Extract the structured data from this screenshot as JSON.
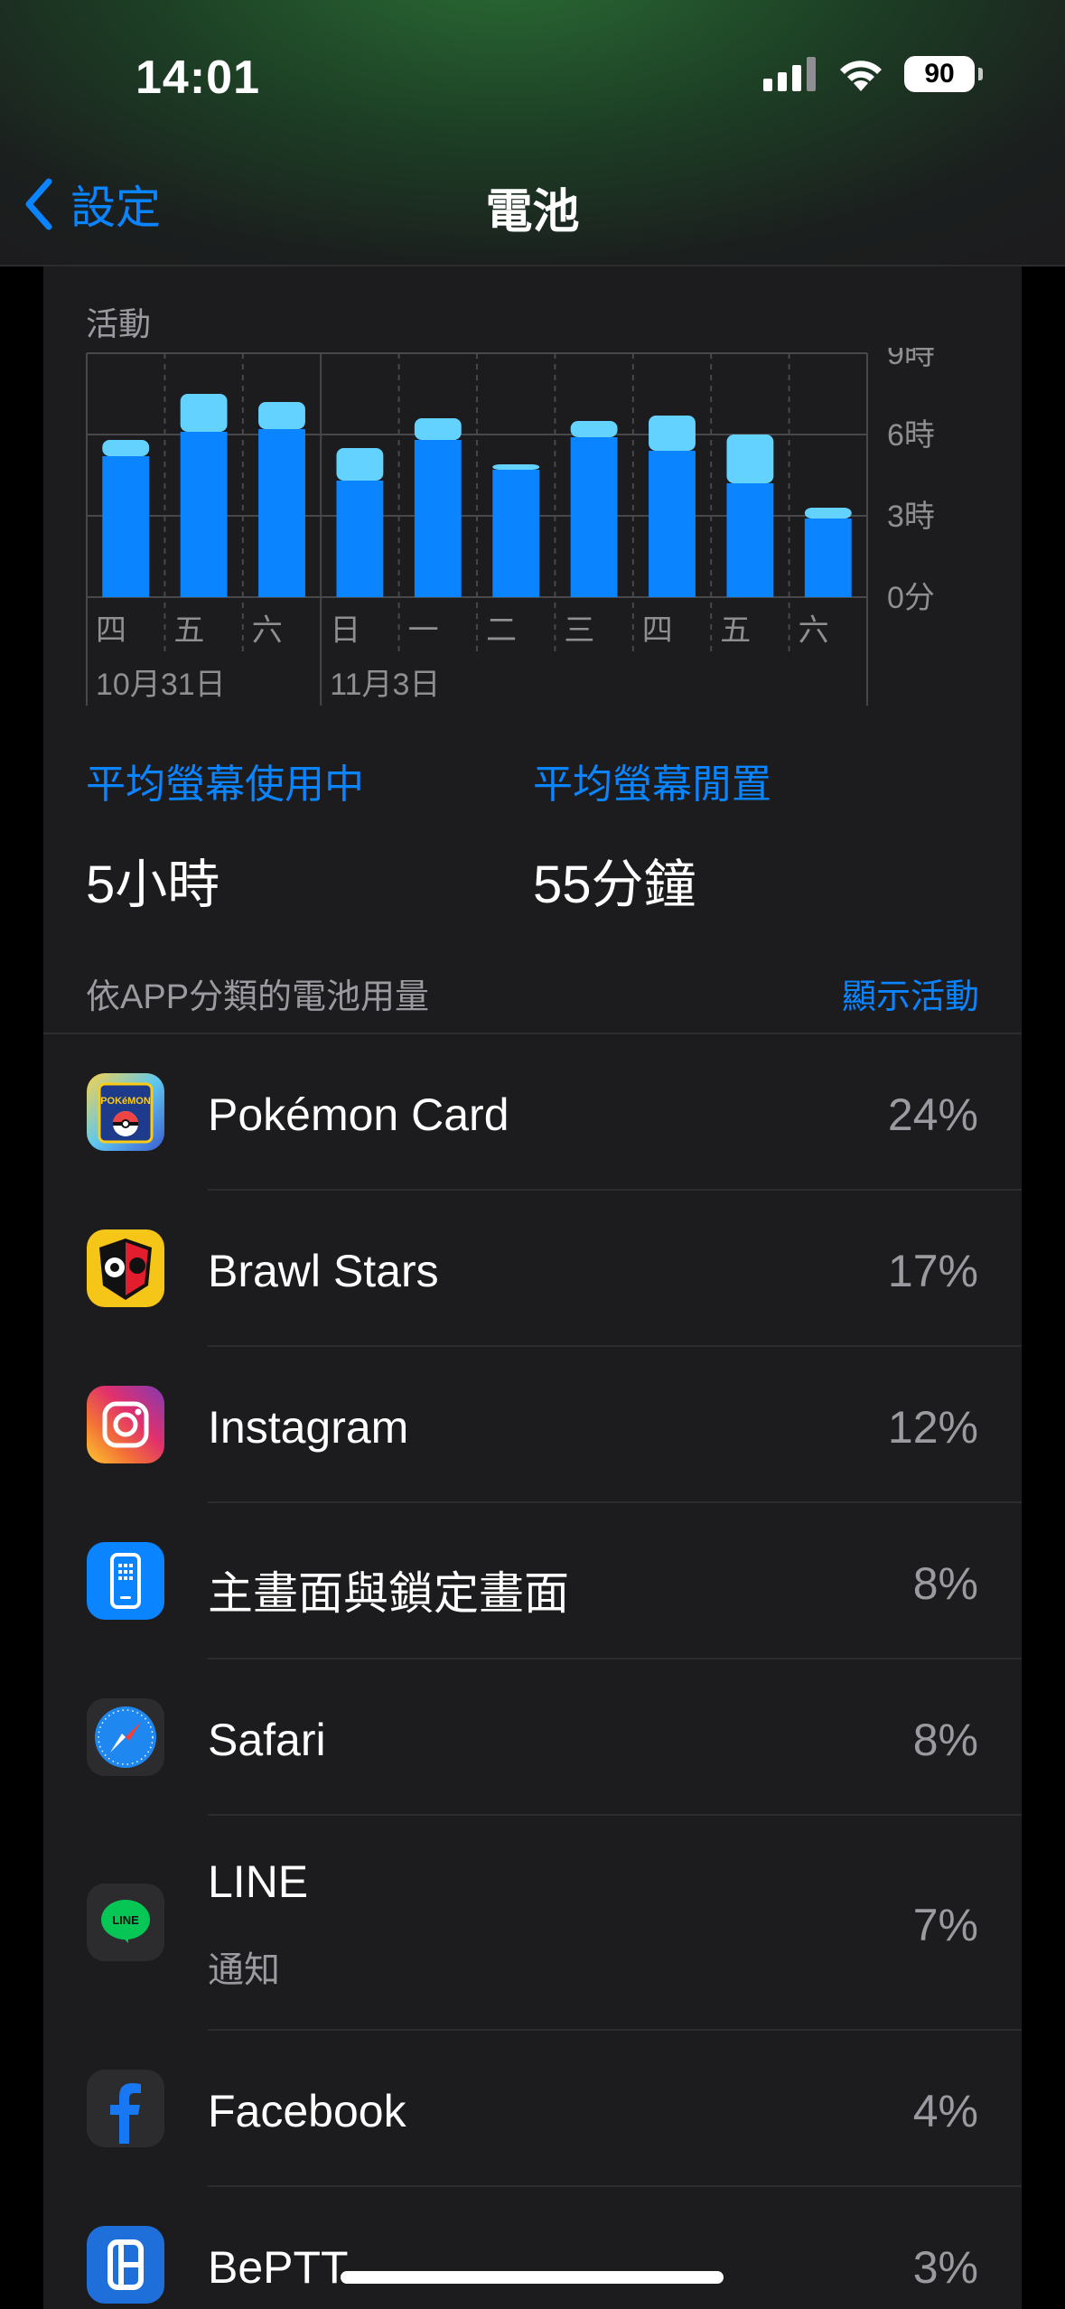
{
  "status": {
    "time": "14:01",
    "battery": "90"
  },
  "nav": {
    "back_label": "設定",
    "title": "電池"
  },
  "activity": {
    "label": "活動"
  },
  "chart_data": {
    "type": "bar",
    "title": "",
    "categories": [
      "四",
      "五",
      "六",
      "日",
      "一",
      "二",
      "三",
      "四",
      "五",
      "六"
    ],
    "date_labels": [
      {
        "index": 0,
        "text": "10月31日"
      },
      {
        "index": 3,
        "text": "11月3日"
      }
    ],
    "series": [
      {
        "name": "",
        "values": [
          5.2,
          6.1,
          6.2,
          4.3,
          5.8,
          4.7,
          5.9,
          5.4,
          4.2,
          2.9
        ],
        "color": "#0a84ff"
      },
      {
        "name": "",
        "values": [
          0.6,
          1.4,
          1.0,
          1.2,
          0.8,
          0.2,
          0.6,
          1.3,
          1.8,
          0.4
        ],
        "color": "#64d2ff"
      }
    ],
    "stacked": true,
    "y_ticks": [
      "0分",
      "3時",
      "6時",
      "9時"
    ],
    "ylim": [
      0,
      9
    ],
    "grid": true
  },
  "averages": {
    "screen_on_label": "平均螢幕使用中",
    "screen_on_value": "5小時",
    "screen_off_label": "平均螢幕閒置",
    "screen_off_value": "55分鐘"
  },
  "usage": {
    "header_label": "依APP分類的電池用量",
    "show_activity": "顯示活動",
    "apps": [
      {
        "name": "Pokémon Card",
        "sub": "",
        "pct": "24%",
        "icon": "pokemon-card-icon"
      },
      {
        "name": "Brawl Stars",
        "sub": "",
        "pct": "17%",
        "icon": "brawl-stars-icon"
      },
      {
        "name": "Instagram",
        "sub": "",
        "pct": "12%",
        "icon": "instagram-icon"
      },
      {
        "name": "主畫面與鎖定畫面",
        "sub": "",
        "pct": "8%",
        "icon": "home-lock-screen-icon"
      },
      {
        "name": "Safari",
        "sub": "",
        "pct": "8%",
        "icon": "safari-icon"
      },
      {
        "name": "LINE",
        "sub": "通知",
        "pct": "7%",
        "icon": "line-icon"
      },
      {
        "name": "Facebook",
        "sub": "",
        "pct": "4%",
        "icon": "facebook-icon"
      },
      {
        "name": "BePTT",
        "sub": "",
        "pct": "3%",
        "icon": "beptt-icon"
      }
    ]
  },
  "colors": {
    "accent": "#0a84ff",
    "bar_primary": "#0a84ff",
    "bar_secondary": "#64d2ff",
    "card": "#1c1c1e"
  }
}
